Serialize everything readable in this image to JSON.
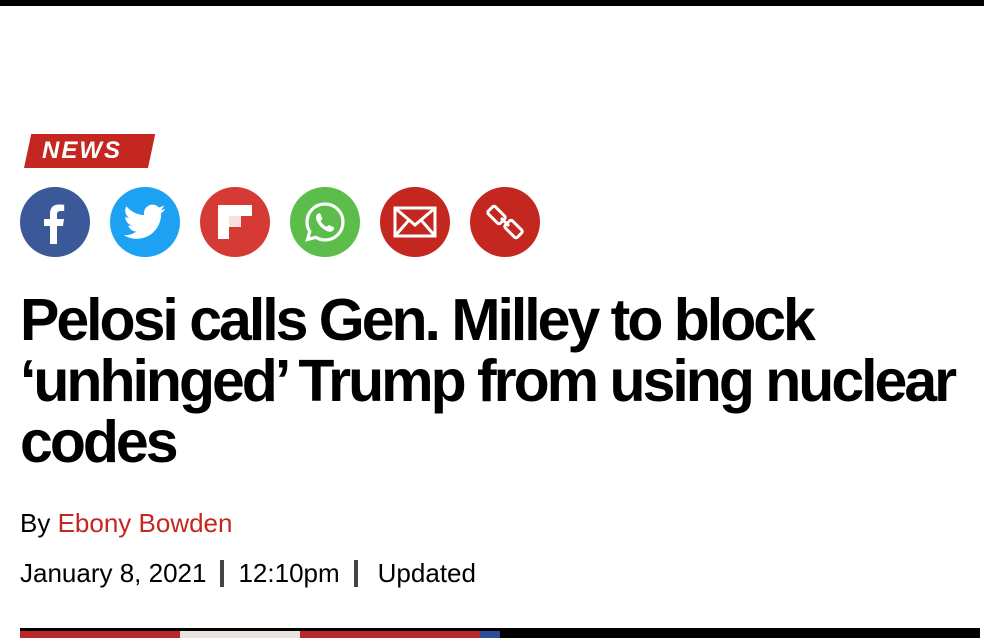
{
  "article": {
    "category": "NEWS",
    "headline": "Pelosi calls Gen. Milley to block ‘unhinged’ Trump from using nuclear codes",
    "byline_prefix": "By",
    "author": "Ebony Bowden",
    "date": "January 8, 2021",
    "time": "12:10pm",
    "updated_label": "Updated"
  },
  "share": [
    {
      "name": "facebook",
      "icon": "facebook-icon",
      "color": "#3b5998"
    },
    {
      "name": "twitter",
      "icon": "twitter-bird-icon",
      "color": "#1da1f2"
    },
    {
      "name": "flipboard",
      "icon": "flipboard-icon",
      "color": "#d63a35"
    },
    {
      "name": "whatsapp",
      "icon": "whatsapp-icon",
      "color": "#5cbd4b"
    },
    {
      "name": "email",
      "icon": "envelope-icon",
      "color": "#c3271f"
    },
    {
      "name": "copy-link",
      "icon": "link-icon",
      "color": "#c3271f"
    }
  ],
  "colors": {
    "brand_red": "#c3271f",
    "top_bar": "#000000"
  }
}
